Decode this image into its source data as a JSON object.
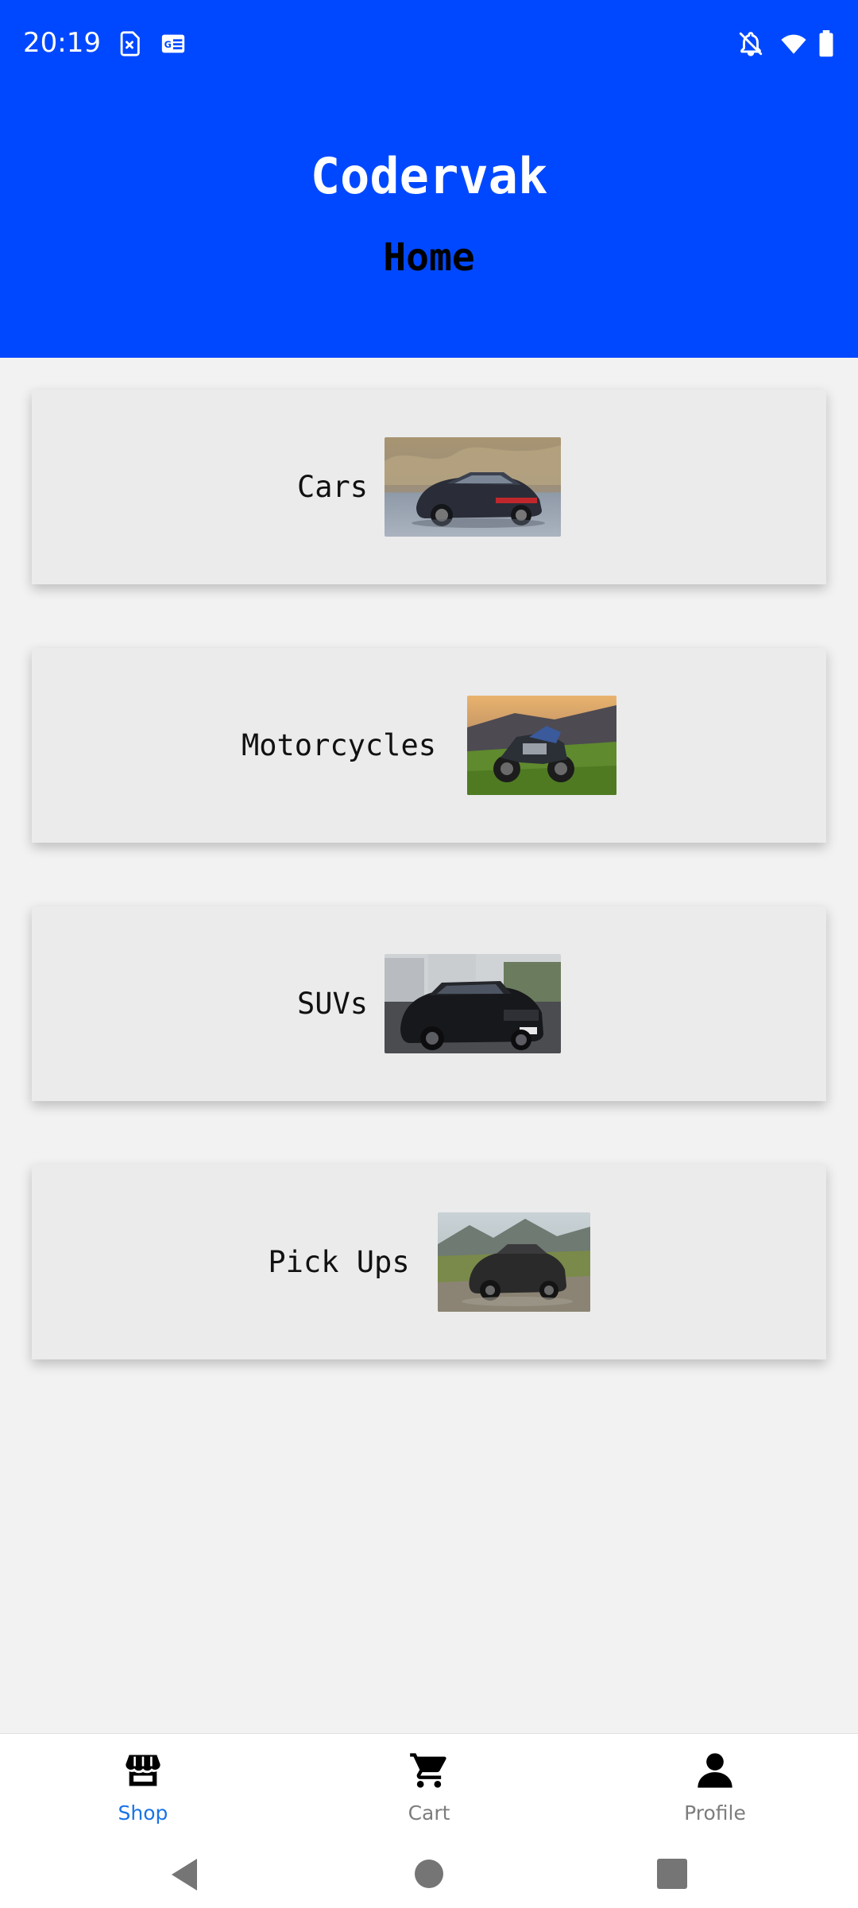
{
  "status_bar": {
    "time": "20:19",
    "left_icons": [
      "sim-card-alert-icon",
      "news-card-icon"
    ],
    "right_icons": [
      "notifications-off-icon",
      "wifi-icon",
      "battery-icon"
    ]
  },
  "header": {
    "app_title": "Codervak",
    "page_title": "Home",
    "background_color": "#0048ff"
  },
  "categories": [
    {
      "label": "Cars",
      "image": "car-photo"
    },
    {
      "label": "Motorcycles",
      "image": "motorcycle-photo"
    },
    {
      "label": "SUVs",
      "image": "suv-photo"
    },
    {
      "label": "Pick Ups",
      "image": "pickup-photo"
    }
  ],
  "bottom_nav": {
    "items": [
      {
        "label": "Shop",
        "icon": "storefront-icon",
        "active": true
      },
      {
        "label": "Cart",
        "icon": "cart-icon",
        "active": false
      },
      {
        "label": "Profile",
        "icon": "person-icon",
        "active": false
      }
    ],
    "active_color": "#1a73e8",
    "inactive_color": "#7d7d7d"
  },
  "system_nav": {
    "buttons": [
      "back-icon",
      "home-icon",
      "recents-icon"
    ]
  }
}
